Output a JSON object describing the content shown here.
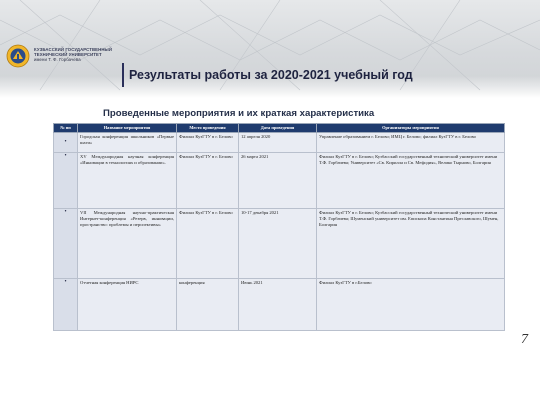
{
  "header": {
    "university_line1": "КУЗБАССКИЙ ГОСУДАРСТВЕННЫЙ",
    "university_line2": "ТЕХНИЧЕСКИЙ УНИВЕРСИТЕТ",
    "university_line3": "имени Т. Ф. Горбачева"
  },
  "slide": {
    "title": "Результаты работы за 2020-2021 учебный год",
    "subtitle": "Проведенные мероприятия и их краткая характеристика",
    "page_number": "7"
  },
  "table": {
    "columns": [
      "№ пп",
      "Название мероприятия",
      "Место проведения",
      "Дата проведения",
      "Организаторы мероприятия"
    ],
    "rows": [
      {
        "num": "•",
        "name": "Городская конференция школьников «Первые шаги»",
        "place": "Филиал КузГТУ в г. Белово",
        "date": "12 апреля 2020",
        "org": "Управление образованием г. Белово; ИМЦ г. Белово; филиал КузГТУ в г. Белово"
      },
      {
        "num": "•",
        "name": "XV Международная научная конференция «Инновации в технологиях и образовании».",
        "place": "Филиал КузГТУ в г. Белово",
        "date": "26 марта 2021",
        "org": "Филиал КузГТУ в г. Белово; Кузбасский государственный технический университет имени Т.Ф. Горбачева; Университет «Св. Кирилла и Св. Мефодия», Велико Тырново, Болгария"
      },
      {
        "num": "•",
        "name": "VII Международная научно-практическая Интернет-конференция «Резерв, инновации, пространство: проблемы и перспективы»",
        "place": "Филиал КузГТУ в г. Белово",
        "date": "10-17 декабря 2021",
        "org": "Филиал КузГТУ в г. Белово; Кузбасский государственный технический университет имени Т.Ф. Горбачева; Шуменский университет им. Епископа Константина Преславского, Шумен, Болгария"
      },
      {
        "num": "•",
        "name": "Отчетная конференция НИРС",
        "place": "конференция",
        "date": "Июнь 2021",
        "org": "Филиал КузГТУ в г.Белово"
      }
    ]
  },
  "colors": {
    "header_fill": "#1f3b6e",
    "title": "#1e2340",
    "cell_fill": "#e9ecf3"
  }
}
